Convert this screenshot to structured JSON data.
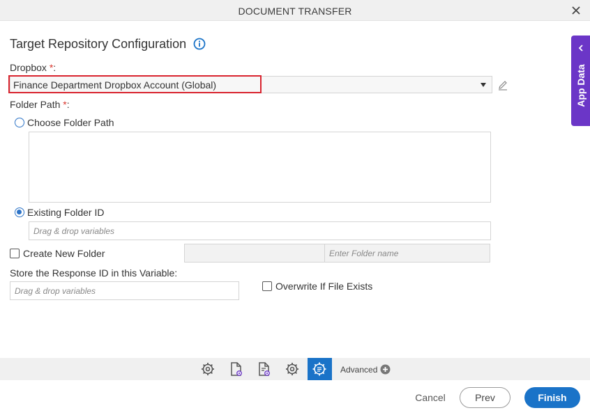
{
  "dialog": {
    "title": "DOCUMENT TRANSFER"
  },
  "section": {
    "title": "Target Repository Configuration"
  },
  "dropbox": {
    "label": "Dropbox",
    "required_mark": "*",
    "colon": ":",
    "value": "Finance Department Dropbox Account (Global)"
  },
  "folder_path": {
    "label": "Folder Path",
    "required_mark": "*",
    "colon": ":",
    "choose_label": "Choose Folder Path",
    "existing_label": "Existing Folder ID",
    "existing_placeholder": "Drag & drop variables",
    "selected": "existing"
  },
  "create_folder": {
    "label": "Create New Folder",
    "checked": false,
    "name_placeholder": "Enter Folder name"
  },
  "response": {
    "label": "Store the Response ID in this Variable:",
    "placeholder": "Drag & drop variables"
  },
  "overwrite": {
    "label": "Overwrite If File Exists",
    "checked": false
  },
  "toolbar": {
    "icons": [
      "gear-icon",
      "document-gear-icon",
      "document-settings-icon",
      "settings-icon",
      "advanced-settings-icon"
    ],
    "advanced_label": "Advanced"
  },
  "footer": {
    "cancel": "Cancel",
    "prev": "Prev",
    "finish": "Finish"
  },
  "side_panel": {
    "label": "App Data"
  },
  "colors": {
    "accent": "#1a73c8",
    "app_data": "#6b36c7",
    "required": "#d9342b",
    "highlight": "#d9232e"
  }
}
